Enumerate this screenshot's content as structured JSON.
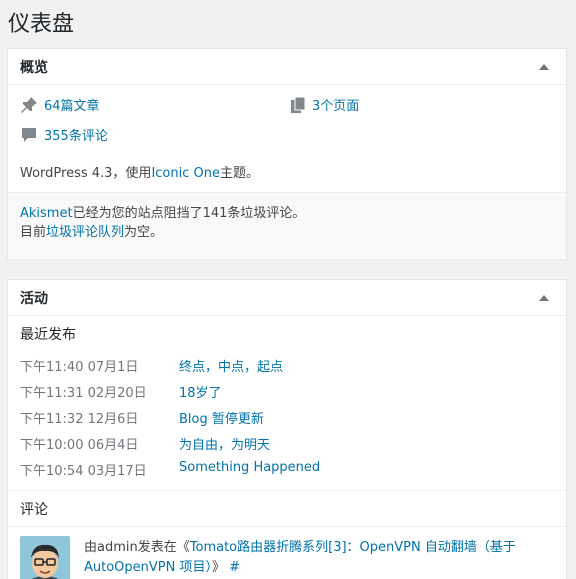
{
  "page": {
    "title": "仪表盘"
  },
  "glance": {
    "title": "概览",
    "posts": "64篇文章",
    "pages": "3个页面",
    "comments": "355条评论",
    "version_prefix": "WordPress 4.3，使用",
    "theme": "Iconic One",
    "version_suffix": "主题。",
    "akismet_link": "Akismet",
    "akismet_text": "已经为您的站点阻挡了141条垃圾评论。",
    "queue_prefix": "目前",
    "queue_link": "垃圾评论队列",
    "queue_suffix": "为空。"
  },
  "activity": {
    "title": "活动",
    "recent_title": "最近发布",
    "posts": [
      {
        "date": "下午11:40 07月1日",
        "title": "终点，中点，起点"
      },
      {
        "date": "下午11:31 02月20日",
        "title": "18岁了"
      },
      {
        "date": "下午11:32 12月6日",
        "title": "Blog 暂停更新"
      },
      {
        "date": "下午10:00 06月4日",
        "title": "为自由，为明天"
      },
      {
        "date": "下午10:54 03月17日",
        "title": "Something Happened"
      }
    ],
    "comments_title": "评论",
    "comment": {
      "author_prefix": "由",
      "author": "admin",
      "mid": "发表在《",
      "post": "Tomato路由器折腾系列[3]：OpenVPN 自动翻墙（基于 AutoOpenVPN 项目）",
      "suffix": "》",
      "hash": "#"
    }
  },
  "colors": {
    "link": "#0073aa",
    "background": "#f1f1f1",
    "panel": "#ffffff"
  },
  "icons": {
    "posts": "pin-icon",
    "pages": "pages-icon",
    "comments": "comment-bubble-icon",
    "toggle": "caret-up-icon"
  }
}
